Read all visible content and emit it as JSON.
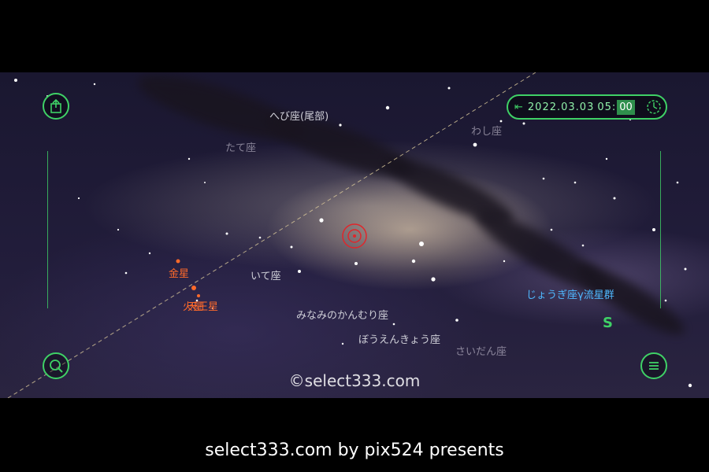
{
  "datetime": {
    "date": "2022.03.03",
    "hour": "05:",
    "minute": "00"
  },
  "labels": {
    "ophiuchus_tail": "へび座(尾部)",
    "scutum": "たて座",
    "aquila": "わし座",
    "sagittarius": "いて座",
    "corona_australis": "みなみのかんむり座",
    "telescopium": "ぼうえんきょう座",
    "ara": "さいだん座",
    "venus": "金星",
    "mars": "火星",
    "uranus": "天王星",
    "meteor_shower": "じょうぎ座γ流星群"
  },
  "compass": {
    "south": "S"
  },
  "watermark": "©select333.com",
  "footer": "select333.com by pix524 presents",
  "icons": {
    "share": "share-icon",
    "search": "search-icon",
    "menu": "menu-icon",
    "collapse": "collapse-arrows-icon",
    "clock": "clock-icon",
    "target": "target-icon"
  },
  "colors": {
    "accent": "#3fd166",
    "planet": "#ff6a2a",
    "meteor": "#4fb8ff",
    "target": "#e0262b"
  }
}
